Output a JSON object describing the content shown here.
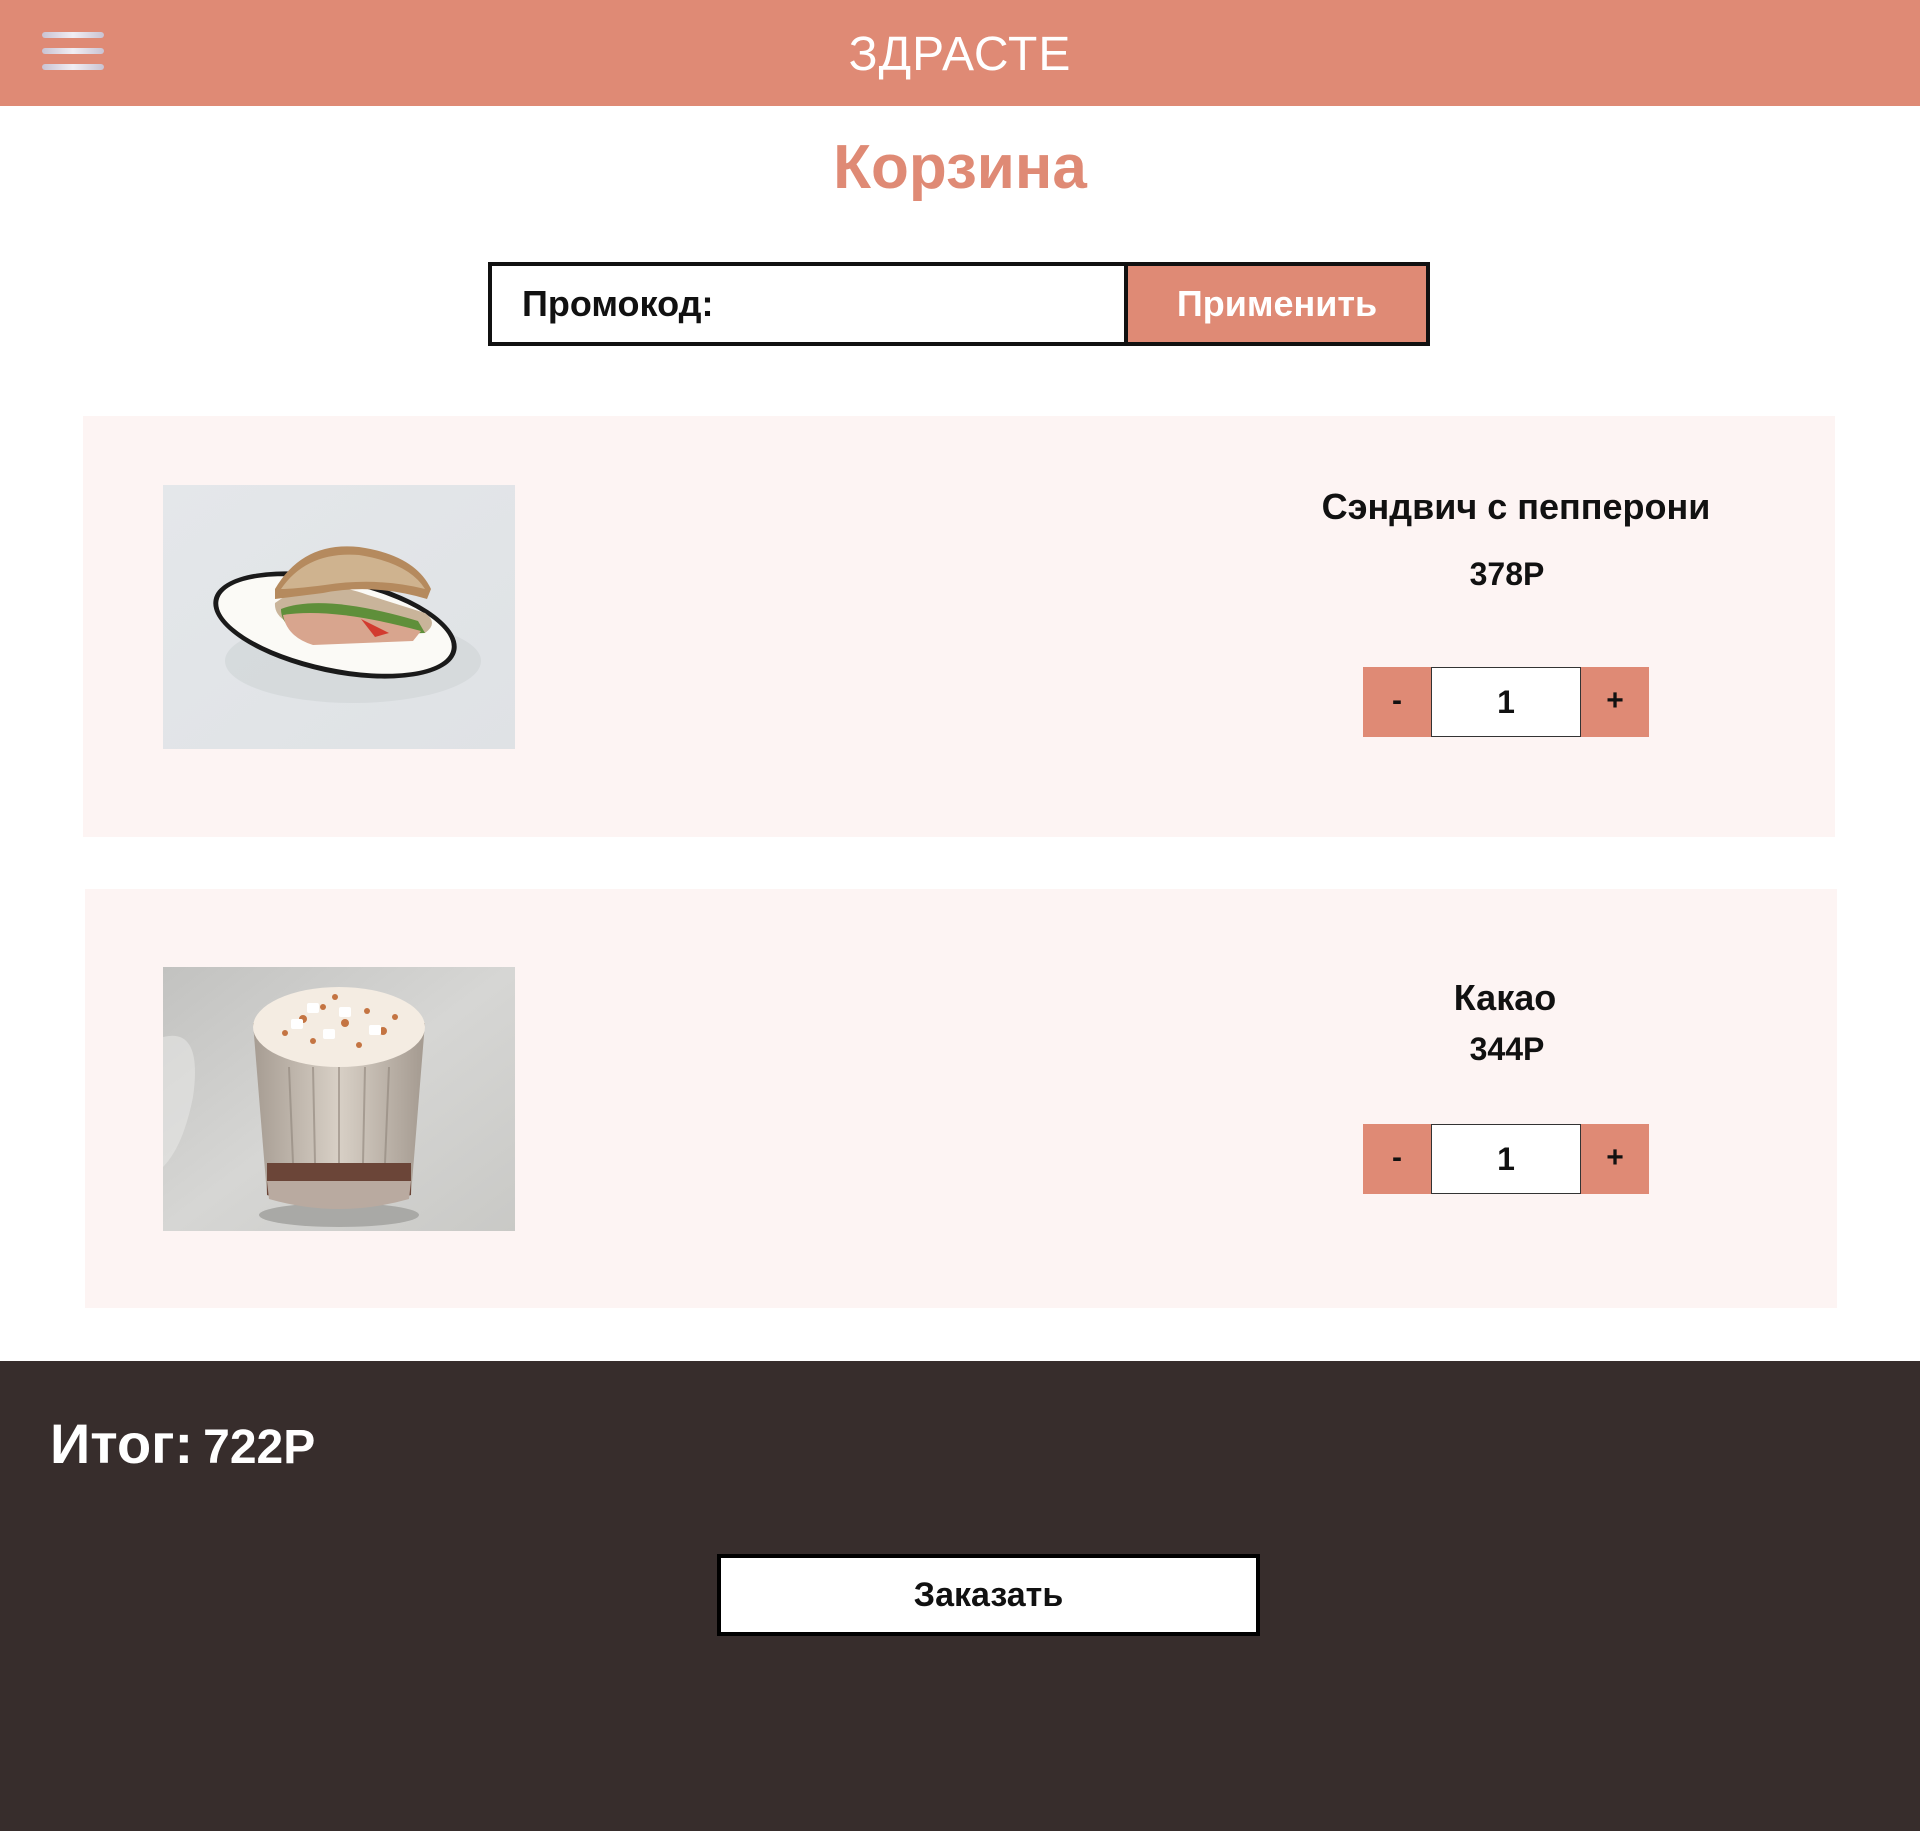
{
  "colors": {
    "accent": "#df8a75",
    "item_background": "#fdf4f3",
    "footer_background": "#372d2c"
  },
  "header": {
    "menu_icon": "hamburger-menu-icon",
    "brand": "ЗДРАСТЕ"
  },
  "page": {
    "title": "Корзина"
  },
  "promo": {
    "placeholder": "Промокод:",
    "value": "",
    "apply_label": "Применить"
  },
  "cart": {
    "items": [
      {
        "name": "Сэндвич с пепперони",
        "price": "378Р",
        "quantity": "1",
        "minus_label": "-",
        "plus_label": "+"
      },
      {
        "name": "Какао",
        "price": "344Р",
        "quantity": "1",
        "minus_label": "-",
        "plus_label": "+"
      }
    ]
  },
  "footer": {
    "total_label": "Итог:",
    "total_value": "722Р",
    "order_label": "Заказать"
  }
}
